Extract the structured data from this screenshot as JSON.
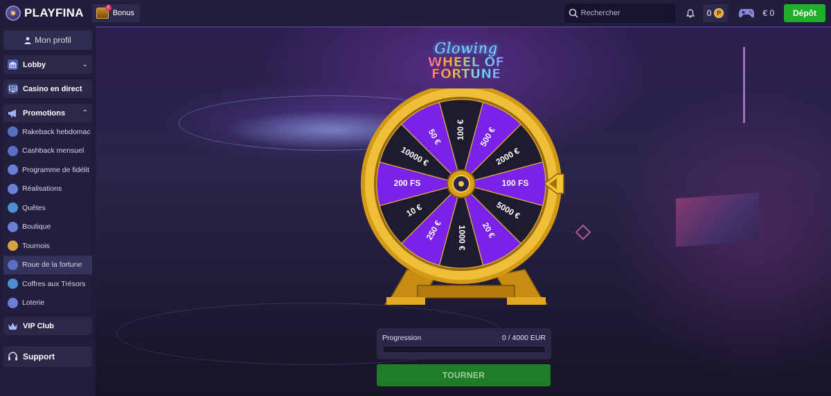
{
  "header": {
    "brand": "PLAYFINA",
    "bonus_label": "Bonus",
    "bonus_badge": "2",
    "search_placeholder": "Rechercher",
    "points": "0",
    "points_icon_label": "P",
    "balance": "€ 0",
    "deposit_label": "Dépôt"
  },
  "sidebar": {
    "profile_label": "Mon profil",
    "lobby_label": "Lobby",
    "live_casino_label": "Casino en direct",
    "promotions_label": "Promotions",
    "promo_items": [
      {
        "label": "Rakeback hebdomac",
        "icon": "rakeback-icon"
      },
      {
        "label": "Cashback mensuel",
        "icon": "cashback-icon"
      },
      {
        "label": "Programme de fidélit",
        "icon": "loyalty-icon"
      },
      {
        "label": "Réalisations",
        "icon": "achievements-icon"
      },
      {
        "label": "Quêtes",
        "icon": "quests-icon"
      },
      {
        "label": "Boutique",
        "icon": "shop-icon"
      },
      {
        "label": "Tournois",
        "icon": "trophy-icon"
      },
      {
        "label": "Roue de la fortune",
        "icon": "wheel-icon"
      },
      {
        "label": "Coffres aux Trésors",
        "icon": "chest-icon"
      },
      {
        "label": "Loterie",
        "icon": "lottery-icon"
      }
    ],
    "vip_label": "VIP Club",
    "support_label": "Support"
  },
  "wheel": {
    "title_script": "Glowing",
    "title_main_1": "WHEEL OF",
    "title_main_2": "FORTUNE",
    "segments": [
      "100 €",
      "500 €",
      "2000 €",
      "100 FS",
      "5000 €",
      "20 €",
      "1000 €",
      "250 €",
      "10 €",
      "200 FS",
      "10000 €",
      "50 €"
    ]
  },
  "progress": {
    "label": "Progression",
    "value": "0 / 4000 EUR",
    "fraction": 0
  },
  "spin_label": "TOURNER",
  "colors": {
    "accent_green": "#1fb02a",
    "wheel_purple": "#7a22e8",
    "wheel_dark": "#1e1b2e",
    "gold": "#e2a91f"
  }
}
